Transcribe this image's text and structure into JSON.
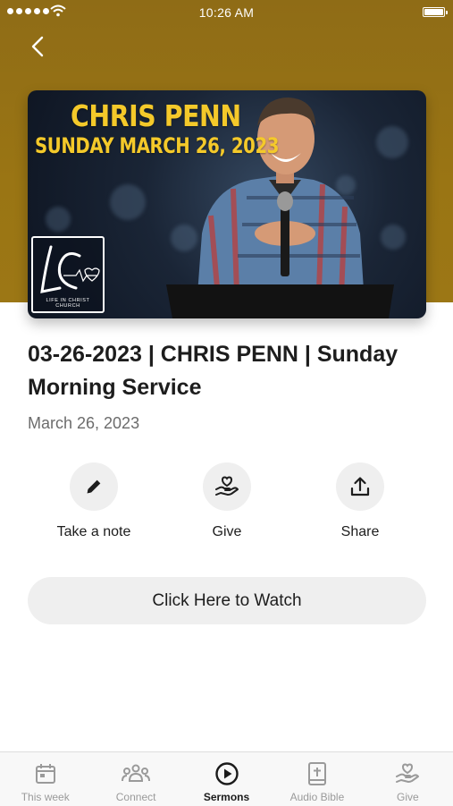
{
  "status_bar": {
    "time": "10:26 AM"
  },
  "poster": {
    "speaker": "CHRIS PENN",
    "date_line": "SUNDAY MARCH 26, 2023",
    "logo_caption": "LIFE IN CHRIST CHURCH"
  },
  "sermon": {
    "title": "03-26-2023 | CHRIS PENN | Sunday Morning Service",
    "date": "March 26, 2023"
  },
  "actions": [
    {
      "label": "Take a note",
      "icon": "pencil-icon"
    },
    {
      "label": "Give",
      "icon": "heart-hand-icon"
    },
    {
      "label": "Share",
      "icon": "share-icon"
    }
  ],
  "watch_button": {
    "label": "Click Here to Watch"
  },
  "tabs": [
    {
      "label": "This week",
      "icon": "calendar-icon"
    },
    {
      "label": "Connect",
      "icon": "people-icon"
    },
    {
      "label": "Sermons",
      "icon": "play-circle-icon"
    },
    {
      "label": "Audio Bible",
      "icon": "bible-icon"
    },
    {
      "label": "Give",
      "icon": "heart-hand-icon"
    }
  ],
  "colors": {
    "header_gold": "#9a7514",
    "poster_text": "#f4c92a",
    "button_bg": "#efefef",
    "tab_inactive": "#9a9a9a"
  }
}
